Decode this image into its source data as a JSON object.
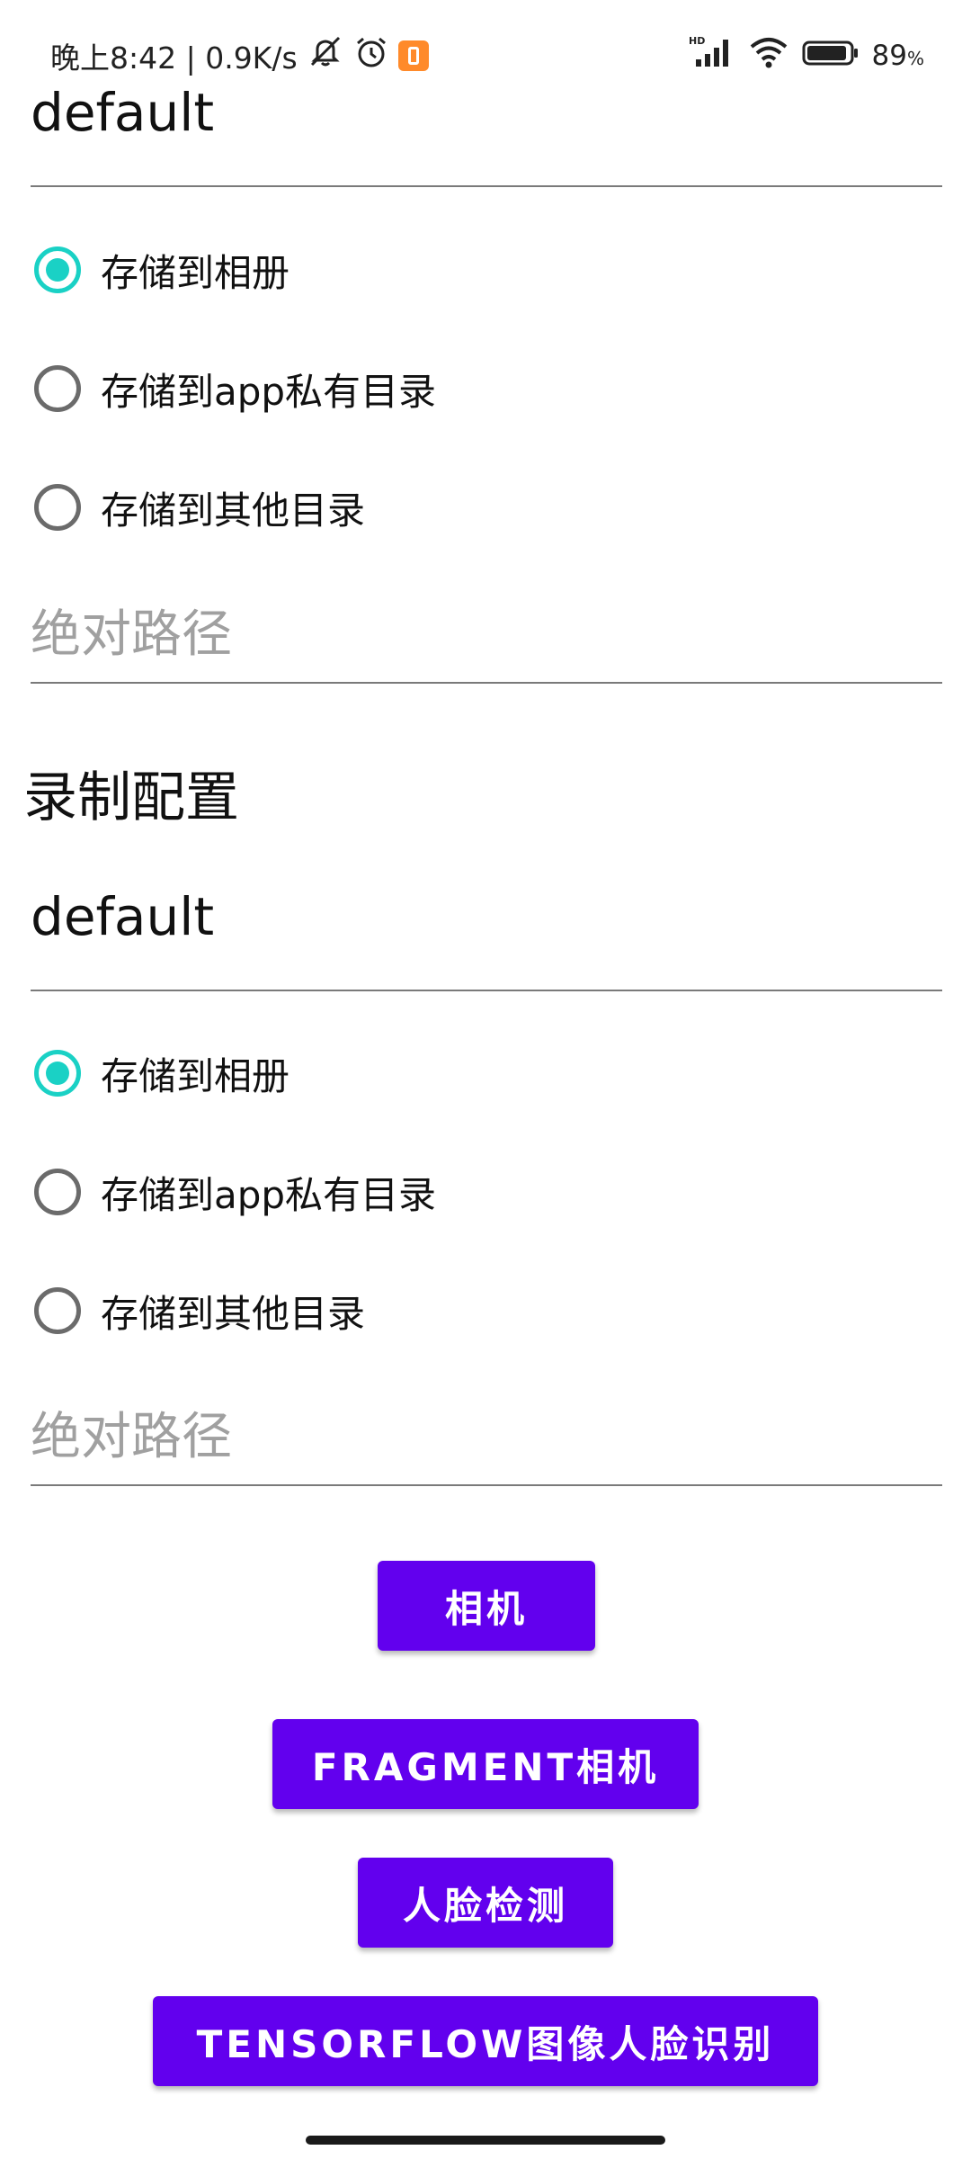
{
  "status_bar": {
    "time_text": "晚上8:42 | 0.9K/s",
    "battery_percent": "89",
    "battery_unit": "%",
    "network_label": "HD",
    "icons": [
      "mute-icon",
      "alarm-icon",
      "app-badge-icon",
      "signal-icon",
      "wifi-icon",
      "battery-icon"
    ]
  },
  "capture_config": {
    "name_value": "default",
    "options": [
      {
        "label": "存储到相册",
        "checked": true
      },
      {
        "label": "存储到app私有目录",
        "checked": false
      },
      {
        "label": "存储到其他目录",
        "checked": false
      }
    ],
    "path_placeholder": "绝对路径"
  },
  "record_config": {
    "title": "录制配置",
    "name_value": "default",
    "options": [
      {
        "label": "存储到相册",
        "checked": true
      },
      {
        "label": "存储到app私有目录",
        "checked": false
      },
      {
        "label": "存储到其他目录",
        "checked": false
      }
    ],
    "path_placeholder": "绝对路径"
  },
  "buttons": {
    "camera": "相机",
    "fragment_camera": "FRAGMENT相机",
    "face_detect": "人脸检测",
    "tensorflow": "TENSORFLOW图像人脸识别"
  },
  "colors": {
    "accent_radio": "#1ad1c5",
    "button_bg": "#6200ee",
    "badge": "#ff8a2a"
  }
}
